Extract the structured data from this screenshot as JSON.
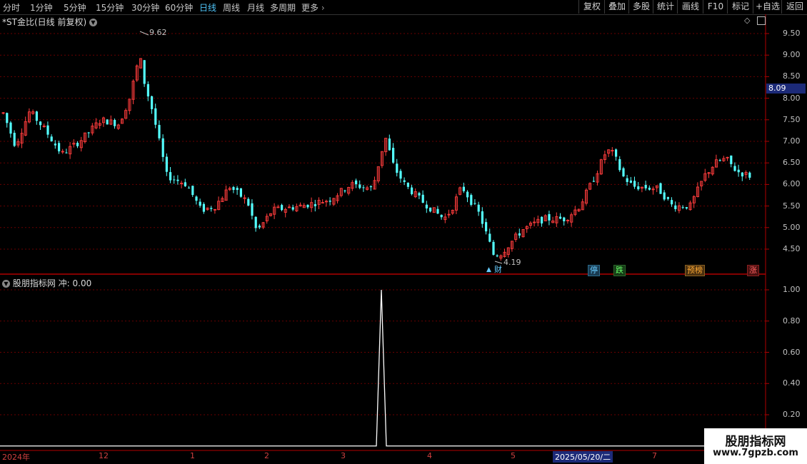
{
  "toolbar": {
    "periods": [
      "分时",
      "1分钟",
      "5分钟",
      "15分钟",
      "30分钟",
      "60分钟",
      "日线",
      "周线",
      "月线",
      "多周期",
      "更多"
    ],
    "active_period": "日线",
    "buttons": [
      "复权",
      "叠加",
      "多股",
      "统计",
      "画线",
      "F10",
      "标记",
      "+自选",
      "返回"
    ]
  },
  "main_panel": {
    "title": "*ST金比(日线 前复权)",
    "price_axis": [
      "9.50",
      "9.00",
      "8.50",
      "8.00",
      "7.50",
      "7.00",
      "6.50",
      "6.00",
      "5.50",
      "5.00",
      "4.50"
    ],
    "current_price_tag": "8.09",
    "high_label": "9.62",
    "low_label": "4.19",
    "markers": [
      {
        "text": "财",
        "color": "#66ccff",
        "bg": "#000",
        "border": "#000"
      },
      {
        "text": "停",
        "color": "#66ccff",
        "bg": "#1a3a50",
        "border": "#2a6a8a"
      },
      {
        "text": "跌",
        "color": "#66ff66",
        "bg": "#163a16",
        "border": "#2a6a2a"
      },
      {
        "text": "预榜",
        "color": "#ffaa33",
        "bg": "#4a3010",
        "border": "#8a6020"
      },
      {
        "text": "涨",
        "color": "#ff6060",
        "bg": "#4a1010",
        "border": "#8a2020"
      }
    ]
  },
  "indicator_panel": {
    "title": "股朋指标网",
    "line_label": "冲:",
    "line_value": "0.00",
    "axis": [
      "1.00",
      "0.80",
      "0.60",
      "0.40",
      "0.20"
    ]
  },
  "date_axis": [
    "2024年",
    "12",
    "1",
    "2",
    "3",
    "4",
    "5",
    "2025/05/20/二",
    "7"
  ],
  "watermark": {
    "title": "股朋指标网",
    "url": "www.7gpzb.com"
  },
  "colors": {
    "up": "#ff3c3c",
    "down": "#54ffff",
    "grid": "#8b0000",
    "axis": "#b00000",
    "active_period": "#4fc3f7"
  }
}
